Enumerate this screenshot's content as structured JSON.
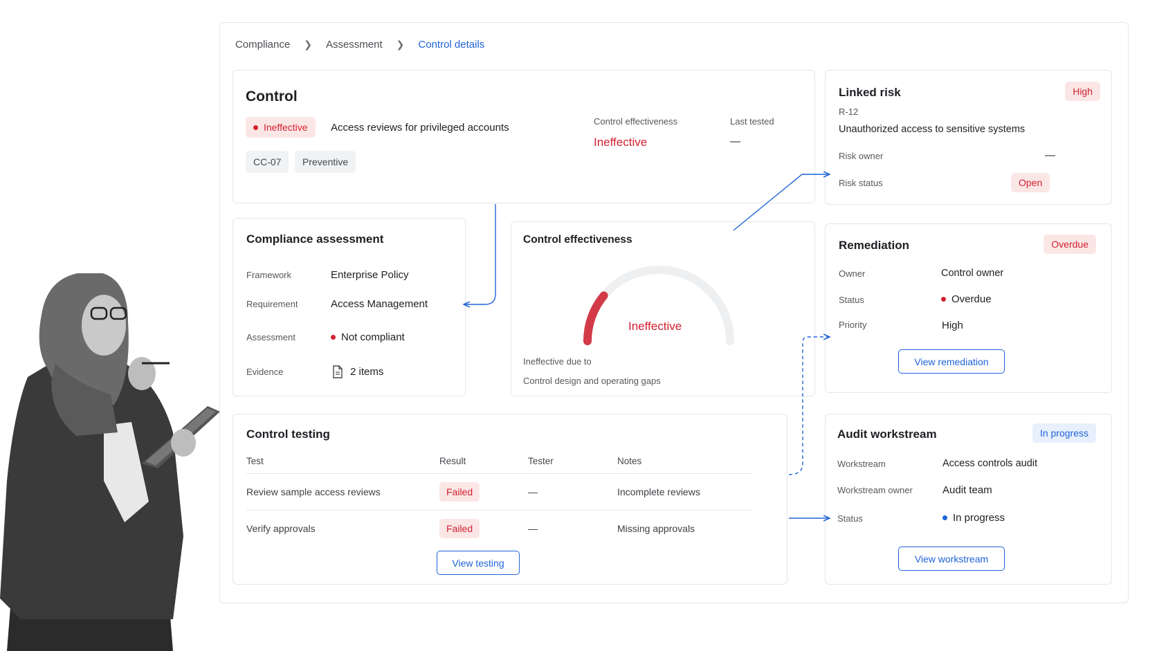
{
  "breadcrumb": {
    "items": [
      "Compliance",
      "Assessment"
    ],
    "current": "Control details"
  },
  "control": {
    "title": "Control",
    "status_badge": "Ineffective",
    "description": "Access reviews for privileged accounts",
    "tags": [
      "CC-07",
      "Preventive"
    ],
    "effectiveness_label": "Control effectiveness",
    "effectiveness_value": "Ineffective",
    "last_tested_label": "Last tested",
    "last_tested_value": "—"
  },
  "linked_risk": {
    "title": "Linked risk",
    "severity": "High",
    "id": "R-12",
    "name": "Unauthorized access to sensitive systems",
    "owner_label": "Risk owner",
    "owner_value": "—",
    "status_label": "Risk status",
    "status_value": "Open"
  },
  "assessment": {
    "title": "Compliance assessment",
    "framework_label": "Framework",
    "framework_value": "Enterprise Policy",
    "requirement_label": "Requirement",
    "requirement_value": "Access Management",
    "assessment_label": "Assessment",
    "assessment_value": "Not compliant",
    "evidence_label": "Evidence",
    "evidence_value": "2 items"
  },
  "effectiveness": {
    "title": "Control effectiveness",
    "gauge_value": "Ineffective",
    "gauge_fill": 0.22,
    "reason_label": "Ineffective due to",
    "reason_value": "Control design and operating gaps"
  },
  "remediation": {
    "title": "Remediation",
    "badge": "Overdue",
    "owner_label": "Owner",
    "owner_value": "Control owner",
    "status_label": "Status",
    "status_value": "Overdue",
    "priority_label": "Priority",
    "priority_value": "High",
    "button": "View remediation"
  },
  "testing": {
    "title": "Control testing",
    "columns": [
      "Test",
      "Result",
      "Tester",
      "Notes"
    ],
    "rows": [
      {
        "test": "Review sample access reviews",
        "result": "Failed",
        "tester": "—",
        "notes": "Incomplete reviews"
      },
      {
        "test": "Verify approvals",
        "result": "Failed",
        "tester": "—",
        "notes": "Missing approvals"
      }
    ],
    "button": "View testing"
  },
  "audit": {
    "title": "Audit workstream",
    "badge": "In progress",
    "workstream_label": "Workstream",
    "workstream_value": "Access controls audit",
    "owner_label": "Workstream owner",
    "owner_value": "Audit team",
    "status_label": "Status",
    "status_value": "In progress",
    "button": "View workstream"
  },
  "colors": {
    "accent": "#1f63d6",
    "danger": "#d3202f",
    "danger_bg": "#fbe6e6",
    "info_bg": "#e8f0fd"
  }
}
